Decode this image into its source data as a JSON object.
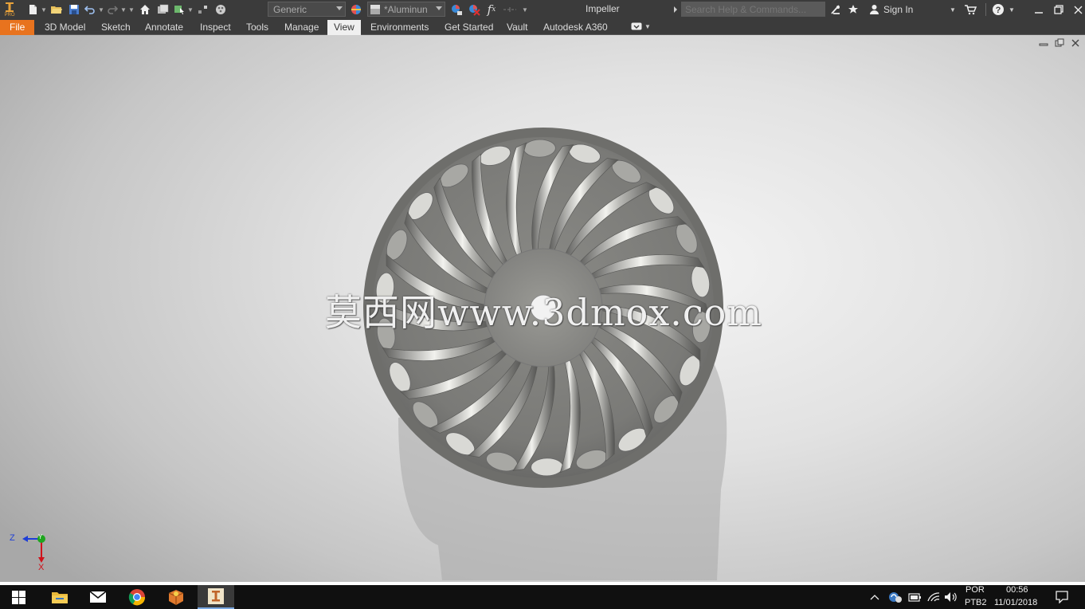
{
  "app": {
    "logo_label": "PRO",
    "document_title": "Impeller"
  },
  "quick_access": {
    "appearance_value": "Generic",
    "material_value": "*Aluminun",
    "function_glyph": "f",
    "function_sub": "x"
  },
  "help": {
    "search_placeholder": "Search Help & Commands..."
  },
  "account": {
    "signin_label": "Sign In"
  },
  "ribbon": {
    "tabs": [
      {
        "label": "File"
      },
      {
        "label": "3D Model"
      },
      {
        "label": "Sketch"
      },
      {
        "label": "Annotate"
      },
      {
        "label": "Inspect"
      },
      {
        "label": "Tools"
      },
      {
        "label": "Manage"
      },
      {
        "label": "View"
      },
      {
        "label": "Environments"
      },
      {
        "label": "Get Started"
      },
      {
        "label": "Vault"
      },
      {
        "label": "Autodesk A360"
      }
    ],
    "active_tab": "View"
  },
  "viewport": {
    "watermark": "莫西网www.3dmox.com",
    "triad": {
      "z": "Z",
      "y": "Y",
      "x": "X"
    }
  },
  "taskbar": {
    "language": "POR",
    "keyboard": "PTB2",
    "time": "00:56",
    "date": "11/01/2018"
  },
  "colors": {
    "file_tab": "#e8731e",
    "titlebar": "#3b3b3b",
    "taskbar": "#101010",
    "axis_x": "#d0121b",
    "axis_y": "#1ea51e",
    "axis_z": "#1f3fd6"
  }
}
